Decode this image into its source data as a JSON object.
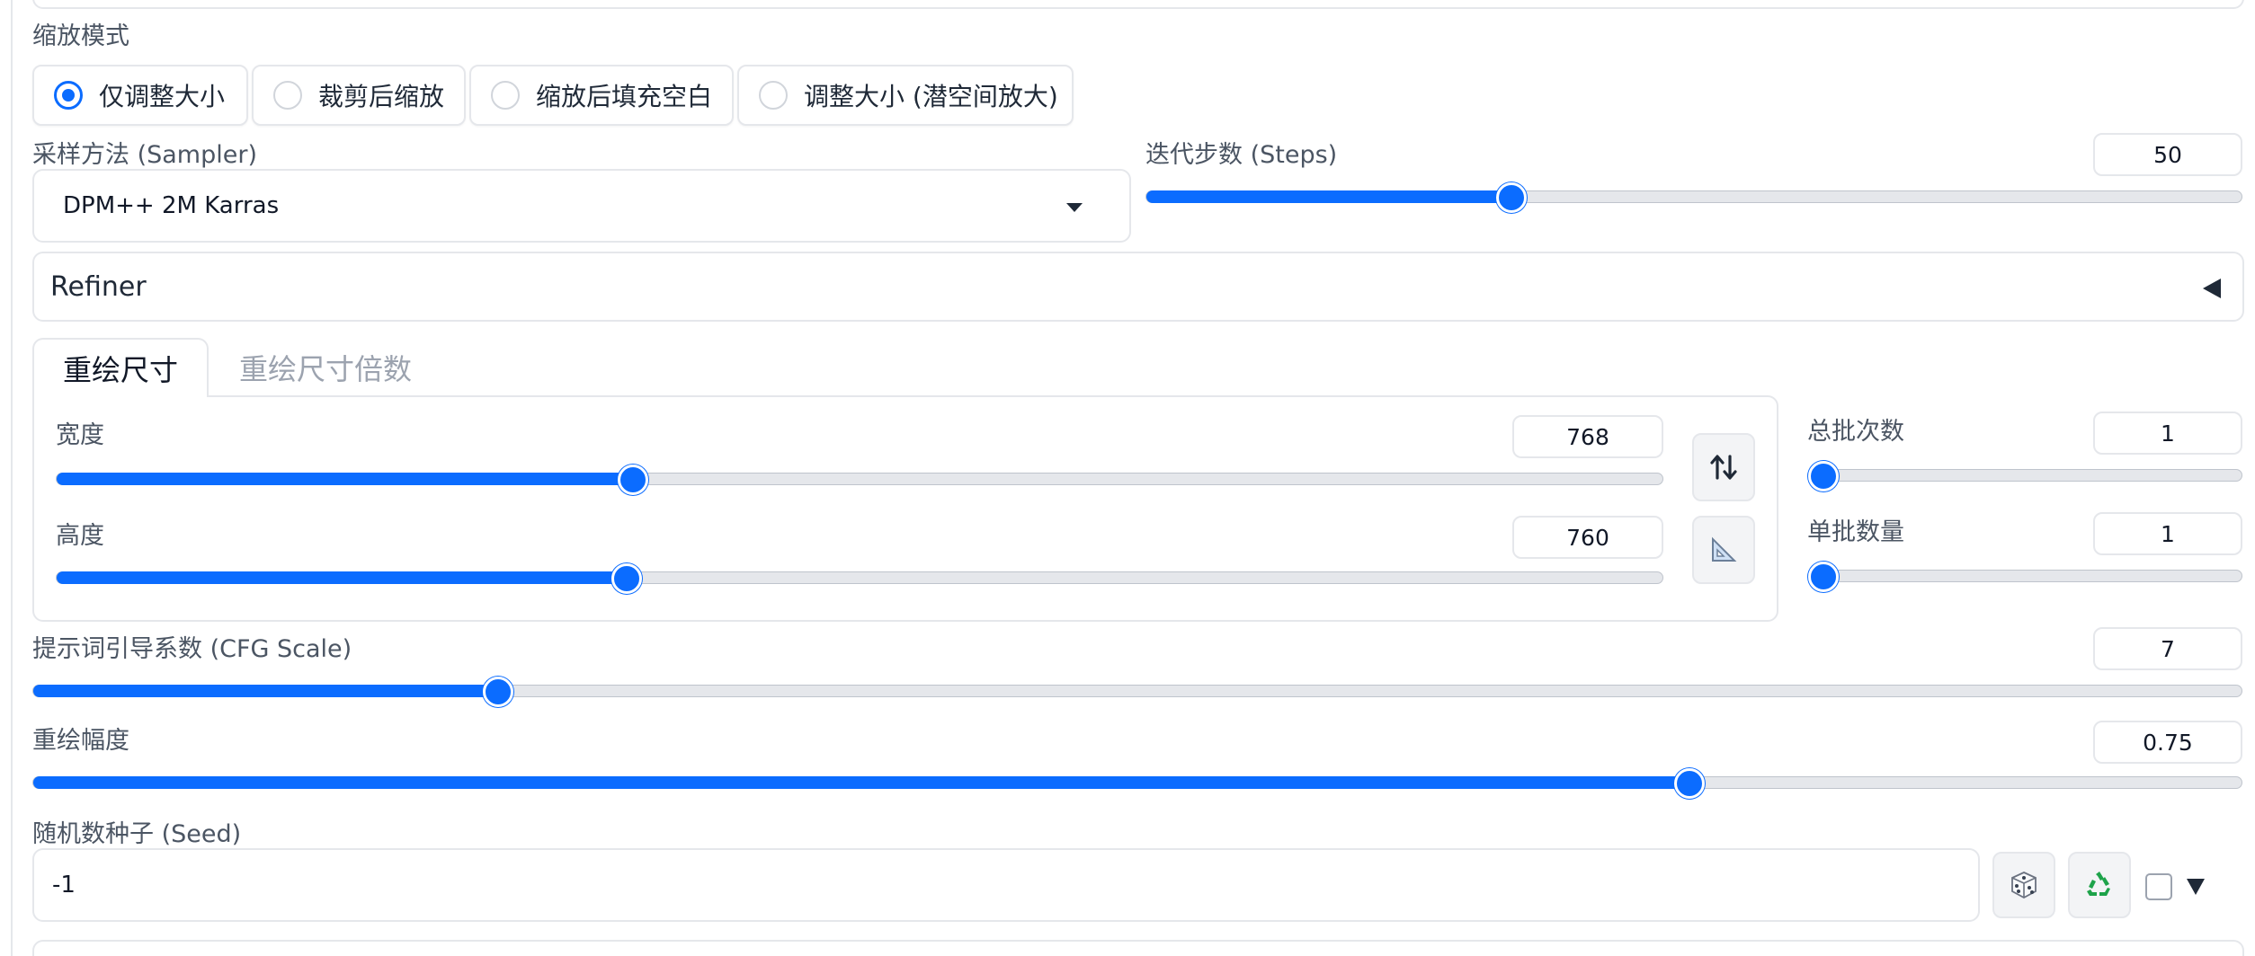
{
  "resize_mode": {
    "label": "缩放模式",
    "options": [
      {
        "label": "仅调整大小",
        "checked": true
      },
      {
        "label": "裁剪后缩放",
        "checked": false
      },
      {
        "label": "缩放后填充空白",
        "checked": false
      },
      {
        "label": "调整大小 (潜空间放大)",
        "checked": false
      }
    ]
  },
  "sampler": {
    "label": "采样方法 (Sampler)",
    "value": "DPM++ 2M Karras"
  },
  "steps": {
    "label": "迭代步数 (Steps)",
    "value": "50",
    "fraction": 0.3333
  },
  "refiner": {
    "label": "Refiner"
  },
  "tabs": [
    {
      "label": "重绘尺寸",
      "active": true
    },
    {
      "label": "重绘尺寸倍数",
      "active": false
    }
  ],
  "width": {
    "label": "宽度",
    "value": "768",
    "fraction": 0.359
  },
  "height": {
    "label": "高度",
    "value": "760",
    "fraction": 0.355
  },
  "batch_count": {
    "label": "总批次数",
    "value": "1",
    "fraction": 0.0
  },
  "batch_size": {
    "label": "单批数量",
    "value": "1",
    "fraction": 0.0
  },
  "cfg_scale": {
    "label": "提示词引导系数 (CFG Scale)",
    "value": "7",
    "fraction": 0.2105
  },
  "denoise": {
    "label": "重绘幅度",
    "value": "0.75",
    "fraction": 0.75
  },
  "seed": {
    "label": "随机数种子 (Seed)",
    "value": "-1"
  },
  "icons": {
    "swap": "swap-dimensions-icon",
    "ratio": "triangle-ruler-icon",
    "dice": "dice-icon",
    "recycle": "recycle-icon",
    "extra_toggle": "triangle-down-icon"
  },
  "colors": {
    "accent": "#0b6cff",
    "border": "#e5e7eb",
    "track": "#e5e7eb"
  }
}
